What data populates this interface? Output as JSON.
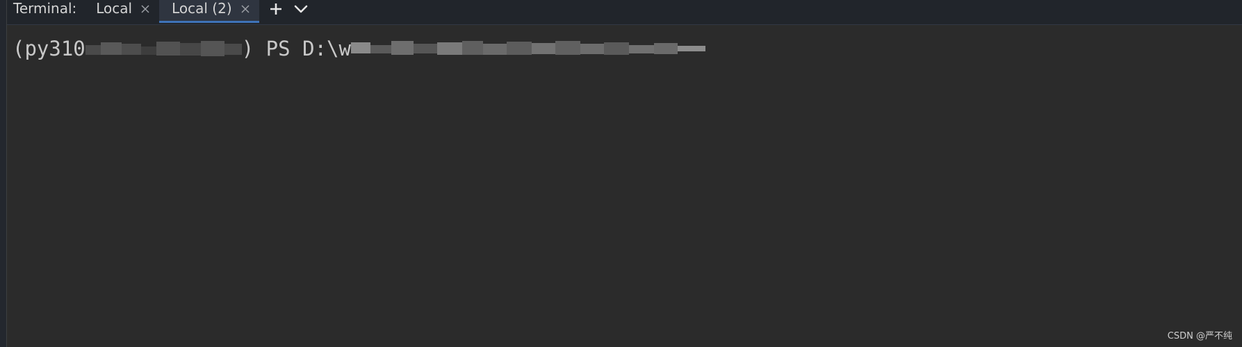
{
  "terminal": {
    "label": "Terminal:",
    "tabs": [
      {
        "label": "Local",
        "active": false
      },
      {
        "label": "Local (2)",
        "active": true
      }
    ],
    "add_icon": "plus-icon",
    "dropdown_icon": "chevron-down-icon",
    "close_icon": "close-icon"
  },
  "console": {
    "prompt_start": "(py310",
    "prompt_middle": ") PS D:\\w",
    "redactions": "pixelated"
  },
  "watermark": "CSDN @严不纯",
  "colors": {
    "tabbar_bg": "#21252b",
    "active_tab_bg": "#2f3540",
    "active_underline": "#3e73b8",
    "console_bg": "#2b2b2b",
    "text": "#d4d4d4"
  }
}
